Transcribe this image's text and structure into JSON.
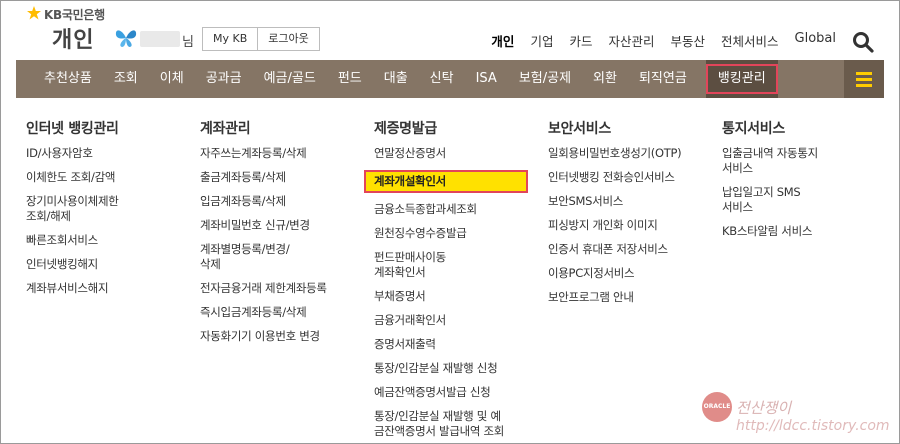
{
  "header": {
    "logo_text": "KB국민은행",
    "site_title": "개인",
    "user_suffix": "님",
    "btn_mykb": "My KB",
    "btn_logout": "로그아웃",
    "topnav": [
      "개인",
      "기업",
      "카드",
      "자산관리",
      "부동산",
      "전체서비스",
      "Global"
    ]
  },
  "nav": {
    "items": [
      "추천상품",
      "조회",
      "이체",
      "공과금",
      "예금/골드",
      "펀드",
      "대출",
      "신탁",
      "ISA",
      "보험/공제",
      "외환",
      "퇴직연금",
      "뱅킹관리"
    ],
    "active": "뱅킹관리"
  },
  "menu": {
    "col1": {
      "title": "인터넷 뱅킹관리",
      "items": [
        "ID/사용자암호",
        "이체한도 조회/감액",
        "장기미사용이체제한\n조회/해제",
        "빠른조회서비스",
        "인터넷뱅킹해지",
        "계좌뷰서비스해지"
      ]
    },
    "col2": {
      "title": "계좌관리",
      "items": [
        "자주쓰는계좌등록/삭제",
        "출금계좌등록/삭제",
        "입금계좌등록/삭제",
        "계좌비밀번호 신규/변경",
        "계좌별명등록/변경/\n삭제",
        "전자금융거래 제한계좌등록",
        "즉시입금계좌등록/삭제",
        "자동화기기 이용번호 변경"
      ]
    },
    "col3": {
      "title": "제증명발급",
      "items": [
        "연말정산증명서",
        "계좌개설확인서",
        "금융소득종합과세조회",
        "원천징수영수증발급",
        "펀드판매사이동\n계좌확인서",
        "부채증명서",
        "금융거래확인서",
        "증명서재출력",
        "통장/인감분실 재발행 신청",
        "예금잔액증명서발급 신청",
        "통장/인감분실 재발행 및 예\n금잔액증명서 발급내역 조회"
      ],
      "highlighted": "계좌개설확인서"
    },
    "col4": {
      "title": "보안서비스",
      "items": [
        "일회용비밀번호생성기(OTP)",
        "인터넷뱅킹 전화승인서비스",
        "보안SMS서비스",
        "피싱방지 개인화 이미지",
        "인증서 휴대폰 저장서비스",
        "이용PC지정서비스",
        "보안프로그램 안내"
      ]
    },
    "col5": {
      "title": "통지서비스",
      "items": [
        "입출금내역 자동통지\n서비스",
        "납입일고지 SMS\n서비스",
        "KB스타알림 서비스"
      ]
    }
  },
  "watermark": {
    "logo": "ORACLE",
    "name": "전산쟁이",
    "url": "http://ldcc.tistory.com"
  },
  "colors": {
    "navbar": "#857565",
    "highlight_fill": "#ffe100",
    "highlight_border": "#e2455a",
    "menu_toggle_bars": "#ffcc00"
  }
}
